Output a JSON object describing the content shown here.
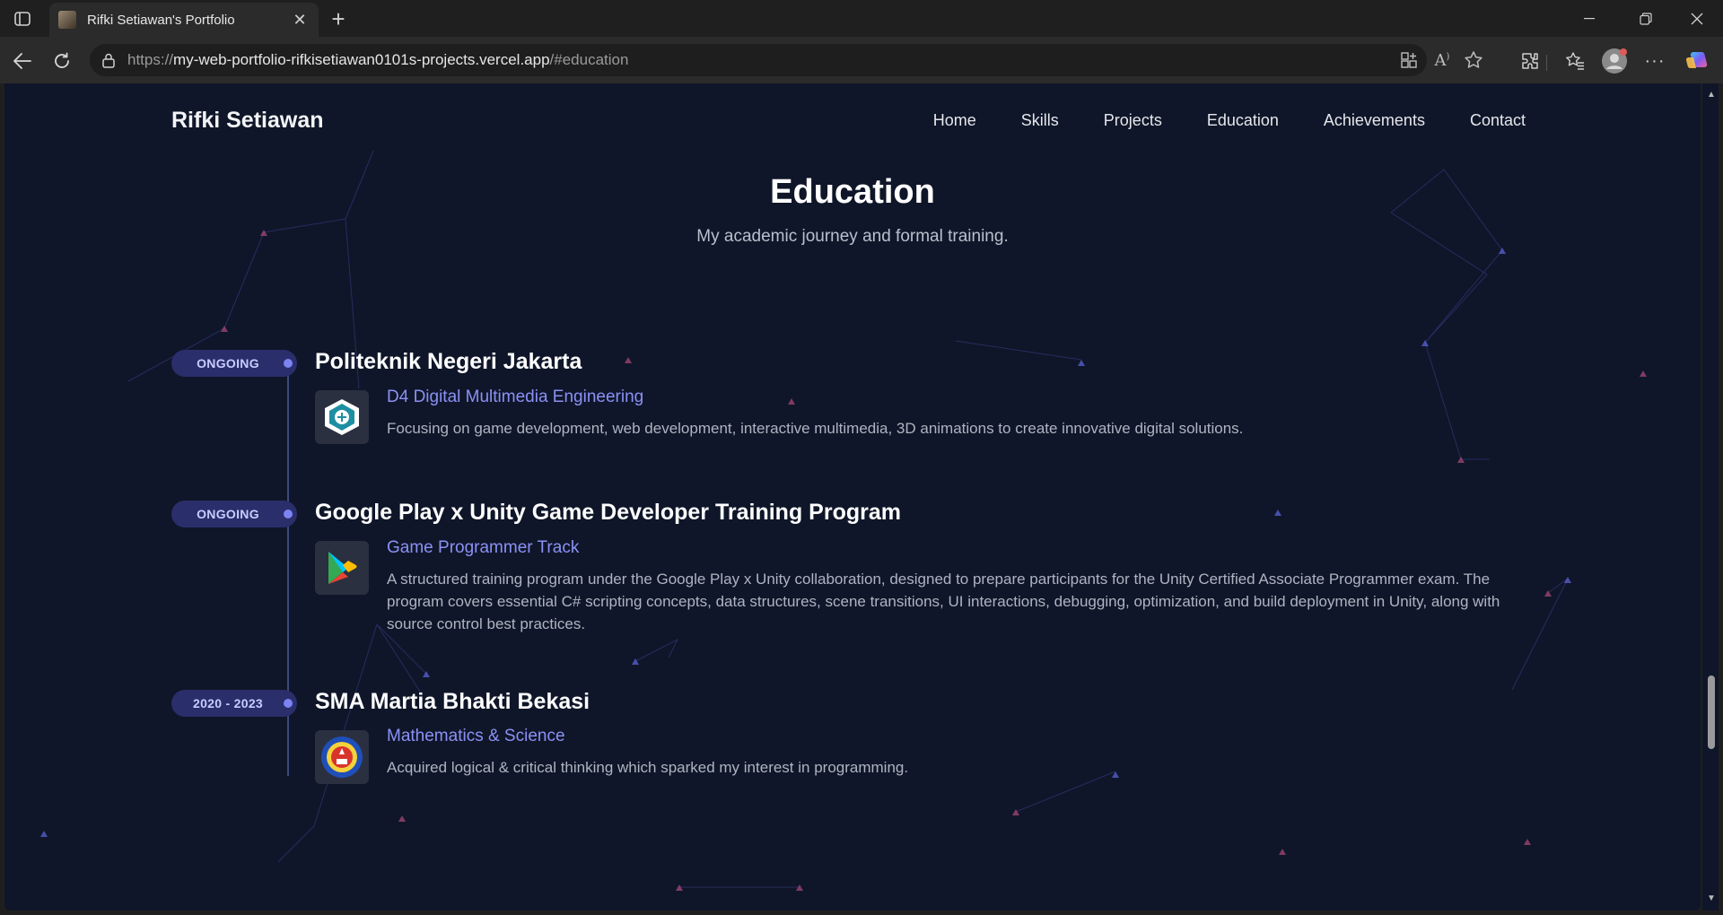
{
  "browser": {
    "tab_title": "Rifki Setiawan's Portfolio",
    "url_prefix": "https://",
    "url_host": "my-web-portfolio-rifkisetiawan0101s-projects.vercel.app",
    "url_path": "/#education"
  },
  "site": {
    "brand": "Rifki Setiawan",
    "nav": [
      "Home",
      "Skills",
      "Projects",
      "Education",
      "Achievements",
      "Contact"
    ]
  },
  "section": {
    "title": "Education",
    "subtitle": "My academic journey and formal training."
  },
  "education": [
    {
      "badge": "ONGOING",
      "title": "Politeknik Negeri Jakarta",
      "subtitle": "D4 Digital Multimedia Engineering",
      "description": "Focusing on game development, web development, interactive multimedia, 3D animations to create innovative digital solutions.",
      "logo": "pnj-logo-icon"
    },
    {
      "badge": "ONGOING",
      "title": "Google Play x Unity Game Developer Training Program",
      "subtitle": "Game Programmer Track",
      "description": "A structured training program under the Google Play x Unity collaboration, designed to prepare participants for the Unity Certified Associate Programmer exam. The program covers essential C# scripting concepts, data structures, scene transitions, UI interactions, debugging, optimization, and build deployment in Unity, along with source control best practices.",
      "logo": "google-play-icon"
    },
    {
      "badge": "2020 - 2023",
      "title": "SMA Martia Bhakti Bekasi",
      "subtitle": "Mathematics & Science",
      "description": "Acquired logical & critical thinking which sparked my interest in programming.",
      "logo": "school-crest-icon"
    }
  ],
  "colors": {
    "page_bg": "#0f1629",
    "accent": "#8b91f5",
    "badge_bg": "#2a2e6b"
  }
}
